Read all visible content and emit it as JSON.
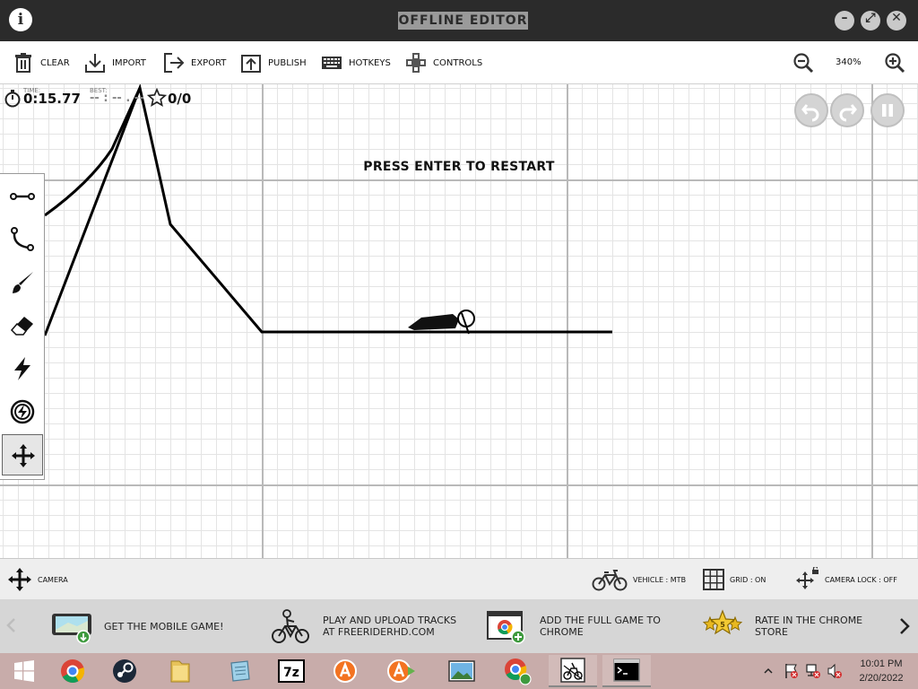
{
  "titlebar": {
    "info_glyph": "i",
    "title": "OFFLINE EDITOR",
    "minimize_glyph": "–",
    "maximize_glyph": "⤢",
    "close_glyph": "✕"
  },
  "toolbar": {
    "clear": "CLEAR",
    "import": "IMPORT",
    "export": "EXPORT",
    "publish": "PUBLISH",
    "hotkeys": "HOTKEYS",
    "controls": "CONTROLS",
    "zoom": "340%"
  },
  "hud": {
    "time_caption": "TIME:",
    "time": "0:15.77",
    "best_caption": "BEST:",
    "best": "-- : -- . --",
    "stars": "0/0"
  },
  "message": "PRESS ENTER TO RESTART",
  "tools": [
    {
      "icon": "straight-line-icon"
    },
    {
      "icon": "curve-icon"
    },
    {
      "icon": "brush-icon"
    },
    {
      "icon": "eraser-icon"
    },
    {
      "icon": "boost-icon"
    },
    {
      "icon": "gravity-icon"
    },
    {
      "icon": "camera-move-icon"
    }
  ],
  "statusbar": {
    "tool": "CAMERA",
    "vehicle": "VEHICLE : MTB",
    "grid": "GRID : ON",
    "camera_lock": "CAMERA LOCK : OFF"
  },
  "promos": [
    {
      "line1": "GET THE MOBILE GAME!",
      "line2": ""
    },
    {
      "line1": "PLAY AND UPLOAD TRACKS",
      "line2": "AT FREERIDERHD.COM"
    },
    {
      "line1": "ADD THE FULL GAME TO",
      "line2": "CHROME"
    },
    {
      "line1": "RATE IN THE CHROME",
      "line2": "STORE",
      "badge": "5"
    }
  ],
  "taskbar": {
    "apps": [
      "windows-start",
      "chrome",
      "steam",
      "file-explorer",
      "notepad",
      "7zip",
      "avast",
      "avast-secondary",
      "photos",
      "chrome-app",
      "free-rider-hd",
      "command-prompt"
    ],
    "clock_time": "10:01 PM",
    "clock_date": "2/20/2022"
  },
  "colors": {
    "titlebar": "#2b2b2b",
    "taskbar": "#c8acaa",
    "track": "#000000",
    "grid_major": "#b9b9b9",
    "grid_minor": "#e4e4e4"
  }
}
